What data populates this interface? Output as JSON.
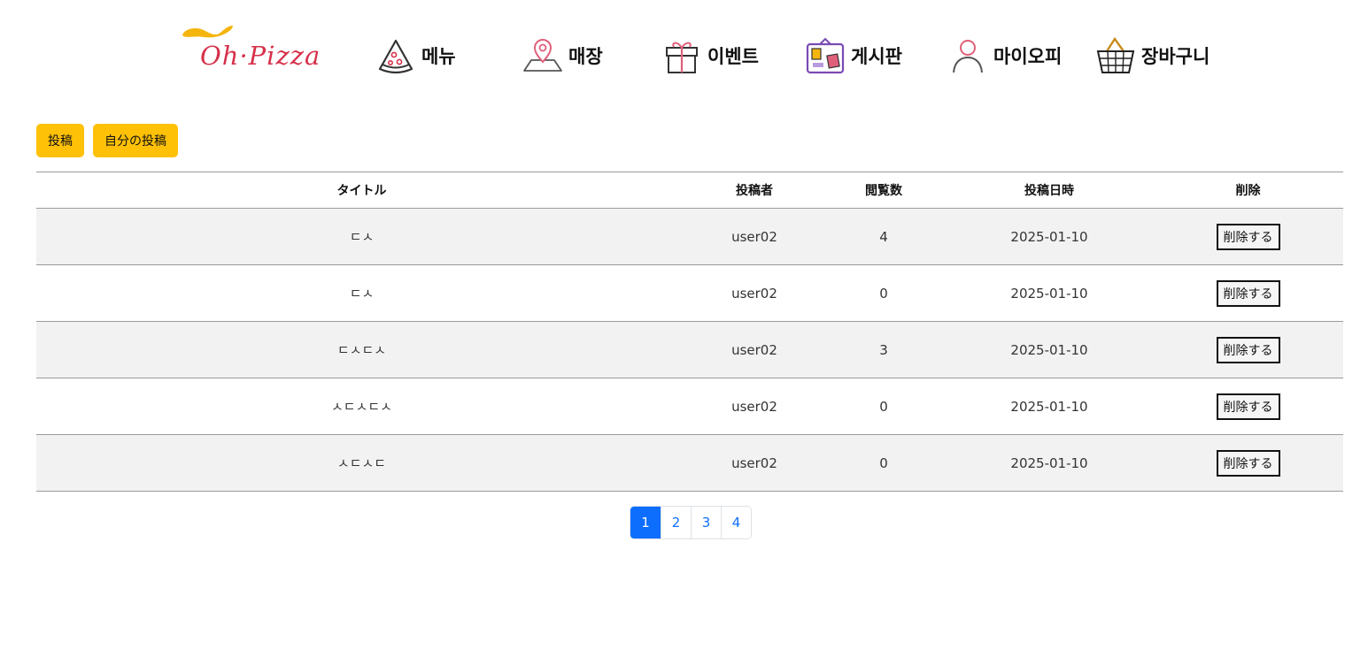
{
  "brand": {
    "logo_text": "Oh·Pizza",
    "logo_color": "#d6304a",
    "swirl_color": "#f5b50f"
  },
  "nav": {
    "items": [
      {
        "label": "메뉴",
        "icon": "pizza-slice-icon"
      },
      {
        "label": "매장",
        "icon": "map-pin-icon"
      },
      {
        "label": "이벤트",
        "icon": "gift-icon"
      },
      {
        "label": "게시판",
        "icon": "bulletin-board-icon"
      },
      {
        "label": "마이오피",
        "icon": "user-icon"
      },
      {
        "label": "장바구니",
        "icon": "basket-icon"
      }
    ]
  },
  "actions": {
    "post_label": "投稿",
    "my_posts_label": "自分の投稿",
    "button_color": "#ffc107"
  },
  "table": {
    "headers": {
      "title": "タイトル",
      "author": "投稿者",
      "views": "閲覧数",
      "date": "投稿日時",
      "delete": "削除"
    },
    "rows": [
      {
        "title": "ㄷㅅ",
        "author": "user02",
        "views": "4",
        "date": "2025-01-10",
        "delete_label": "削除する"
      },
      {
        "title": "ㄷㅅ",
        "author": "user02",
        "views": "0",
        "date": "2025-01-10",
        "delete_label": "削除する"
      },
      {
        "title": "ㄷㅅㄷㅅ",
        "author": "user02",
        "views": "3",
        "date": "2025-01-10",
        "delete_label": "削除する"
      },
      {
        "title": "ㅅㄷㅅㄷㅅ",
        "author": "user02",
        "views": "0",
        "date": "2025-01-10",
        "delete_label": "削除する"
      },
      {
        "title": "ㅅㄷㅅㄷ",
        "author": "user02",
        "views": "0",
        "date": "2025-01-10",
        "delete_label": "削除する"
      }
    ]
  },
  "pagination": {
    "pages": [
      "1",
      "2",
      "3",
      "4"
    ],
    "current": "1",
    "active_color": "#0d6efd"
  }
}
